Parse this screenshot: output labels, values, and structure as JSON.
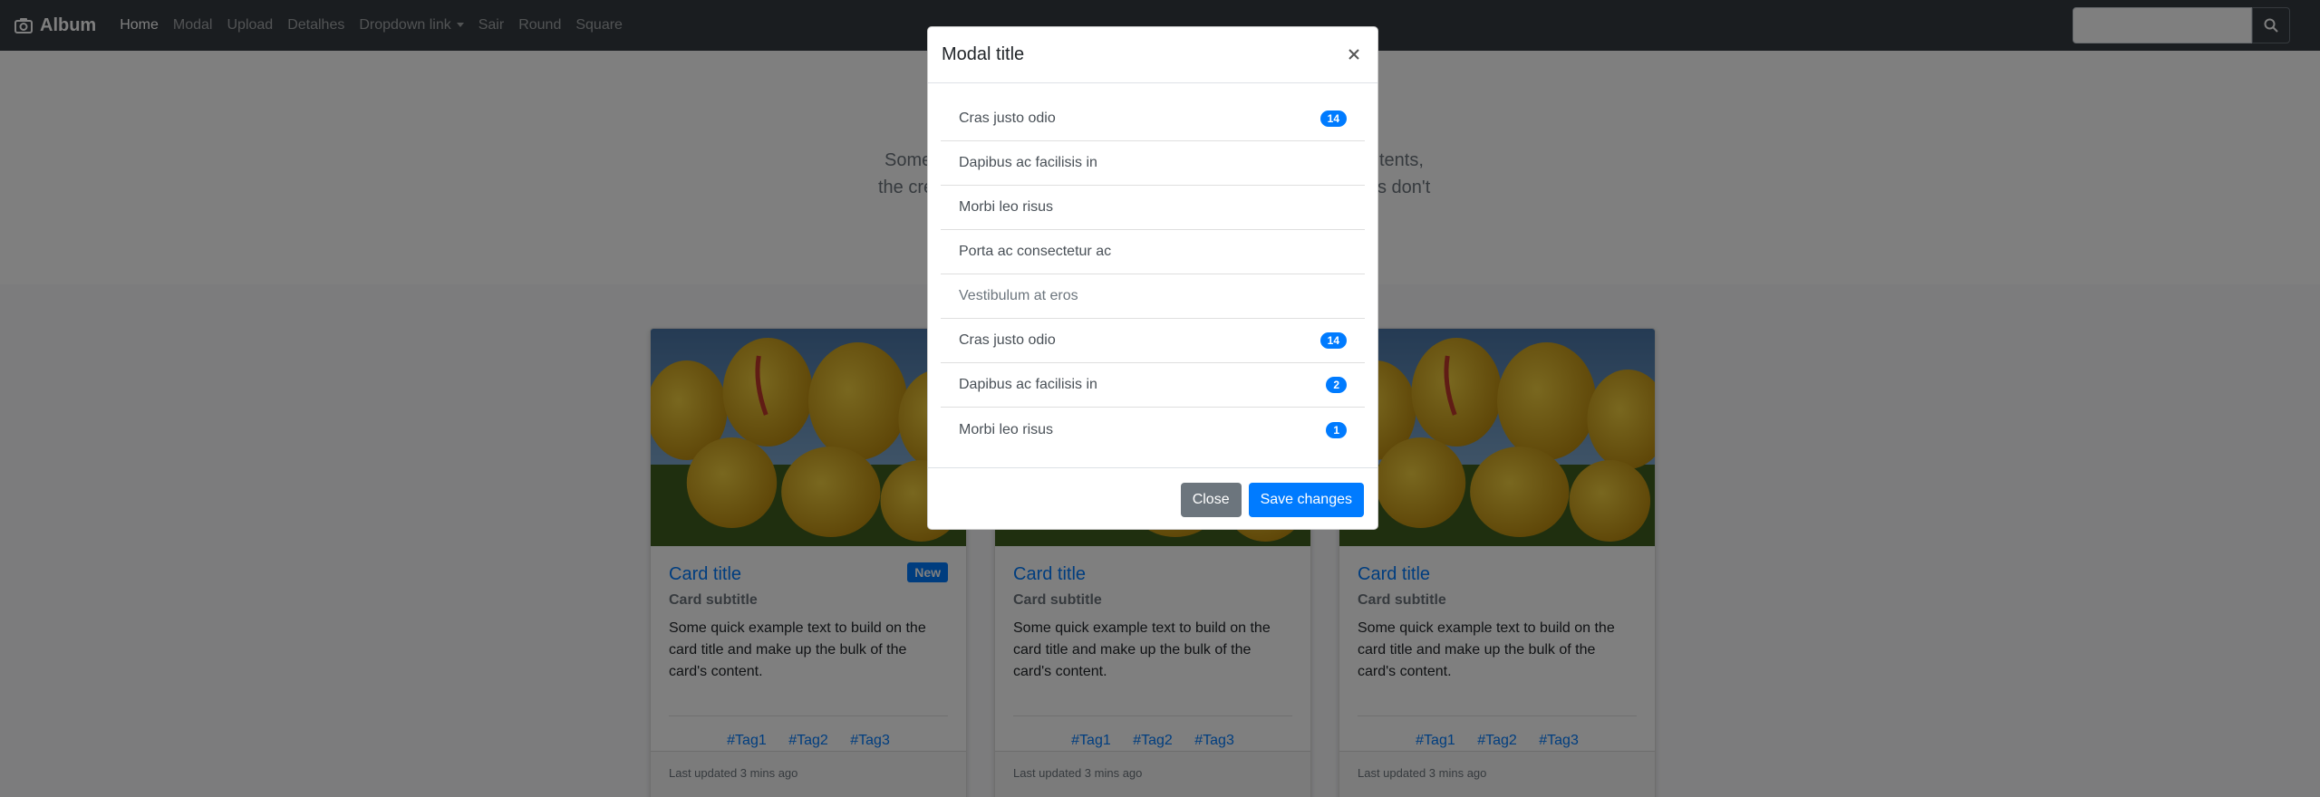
{
  "navbar": {
    "brand": "Album",
    "links": [
      "Home",
      "Modal",
      "Upload",
      "Detalhes",
      "Dropdown link",
      "Sair",
      "Round",
      "Square"
    ],
    "search_placeholder": ""
  },
  "jumbotron": {
    "lead_line1": "Some",
    "lead_line1_end": "tents,",
    "lead_line2": "the cre",
    "lead_line2_end": "s don't"
  },
  "cards": [
    {
      "title": "Card title",
      "badge": "New",
      "subtitle": "Card subtitle",
      "text": "Some quick example text to build on the card title and make up the bulk of the card's content.",
      "tags": [
        "#Tag1",
        "#Tag2",
        "#Tag3"
      ],
      "footer": "Last updated 3 mins ago"
    },
    {
      "title": "Card title",
      "badge": "",
      "subtitle": "Card subtitle",
      "text": "Some quick example text to build on the card title and make up the bulk of the card's content.",
      "tags": [
        "#Tag1",
        "#Tag2",
        "#Tag3"
      ],
      "footer": "Last updated 3 mins ago"
    },
    {
      "title": "Card title",
      "badge": "",
      "subtitle": "Card subtitle",
      "text": "Some quick example text to build on the card title and make up the bulk of the card's content.",
      "tags": [
        "#Tag1",
        "#Tag2",
        "#Tag3"
      ],
      "footer": "Last updated 3 mins ago"
    }
  ],
  "modal": {
    "title": "Modal title",
    "close_icon": "close-icon",
    "items": [
      {
        "label": "Cras justo odio",
        "badge": "14"
      },
      {
        "label": "Dapibus ac facilisis in",
        "badge": ""
      },
      {
        "label": "Morbi leo risus",
        "badge": ""
      },
      {
        "label": "Porta ac consectetur ac",
        "badge": ""
      },
      {
        "label": "Vestibulum at eros",
        "badge": ""
      },
      {
        "label": "Cras justo odio",
        "badge": "14"
      },
      {
        "label": "Dapibus ac facilisis in",
        "badge": "2"
      },
      {
        "label": "Morbi leo risus",
        "badge": "1"
      }
    ],
    "close_label": "Close",
    "save_label": "Save changes"
  },
  "colors": {
    "navbar": "#343a40",
    "primary": "#007bff",
    "secondary": "#6c757d"
  }
}
